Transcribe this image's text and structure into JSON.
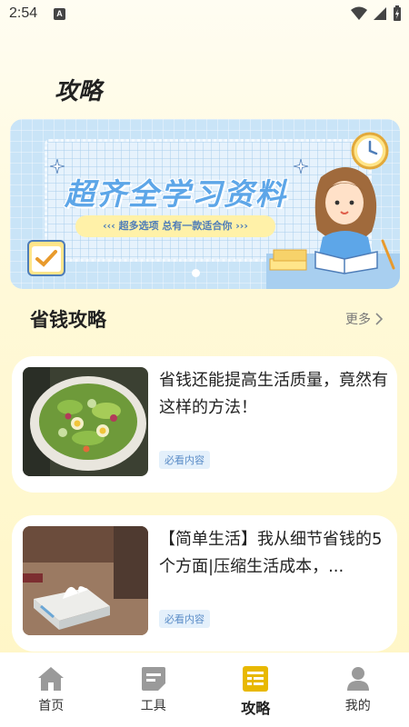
{
  "status_bar": {
    "time": "2:54",
    "indicator": "A"
  },
  "page": {
    "title": "攻略"
  },
  "banner": {
    "title": "超齐全学习资料",
    "pill_text": "超多选项 总有一款适合你",
    "pill_left_arrows": "‹‹‹",
    "pill_right_arrows": "›››"
  },
  "section": {
    "title": "省钱攻略",
    "more_label": "更多"
  },
  "articles": [
    {
      "title": "省钱还能提高生活质量，竟然有这样的方法！",
      "tag": "必看内容",
      "image": "salad-bowl"
    },
    {
      "title": "【简单生活】我从细节省钱的5个方面|压缩生活成本，...",
      "tag": "必看内容",
      "image": "tissue-box-table"
    }
  ],
  "nav": {
    "items": [
      {
        "label": "首页",
        "icon": "home-icon"
      },
      {
        "label": "工具",
        "icon": "tools-icon"
      },
      {
        "label": "攻略",
        "icon": "guide-icon"
      },
      {
        "label": "我的",
        "icon": "profile-icon"
      }
    ],
    "active_index": 2
  },
  "colors": {
    "accent": "#E8B800",
    "banner_bg": "#C9E4F7",
    "title_blue": "#5DA6E8",
    "tag_bg": "#E4F0FB",
    "tag_text": "#5A8CC7"
  }
}
